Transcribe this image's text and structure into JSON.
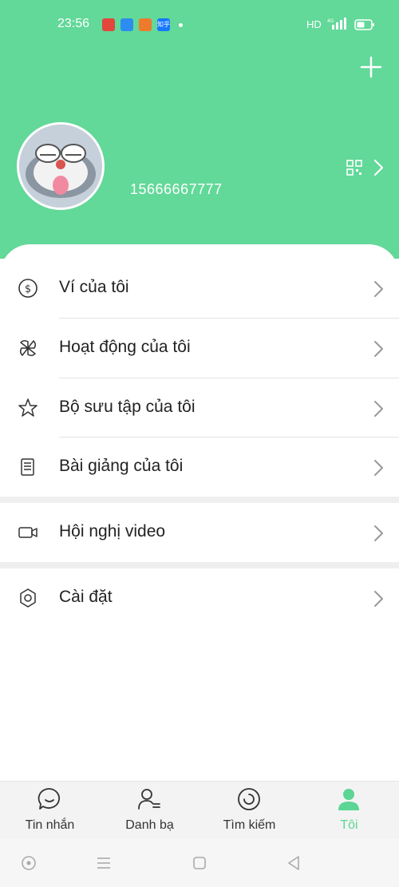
{
  "status_bar": {
    "time": "23:56",
    "network": "HD",
    "icons": [
      "app-icon-1",
      "app-icon-2",
      "app-icon-3",
      "zhihu-icon",
      "dot"
    ],
    "app_colors": [
      "#e2463c",
      "#2d8cf0",
      "#ee7a2b",
      "#1677ff"
    ],
    "zhihu_text": "知乎"
  },
  "header": {
    "background": "#62d899",
    "phone": "15666667777"
  },
  "menu": [
    {
      "label": "Ví của tôi",
      "icon": "wallet-icon"
    },
    {
      "label": "Hoạt động của tôi",
      "icon": "activity-icon"
    },
    {
      "label": "Bộ sưu tập của tôi",
      "icon": "star-icon"
    },
    {
      "label": "Bài giảng của tôi",
      "icon": "document-icon"
    },
    {
      "label": "Hội nghị video",
      "icon": "video-icon"
    },
    {
      "label": "Cài đặt",
      "icon": "settings-icon"
    }
  ],
  "tabs": [
    {
      "label": "Tin nhắn",
      "icon": "message-icon",
      "active": false
    },
    {
      "label": "Danh bạ",
      "icon": "contacts-icon",
      "active": false
    },
    {
      "label": "Tìm kiếm",
      "icon": "explore-icon",
      "active": false
    },
    {
      "label": "Tôi",
      "icon": "me-icon",
      "active": true
    }
  ],
  "accent": "#5cd595"
}
